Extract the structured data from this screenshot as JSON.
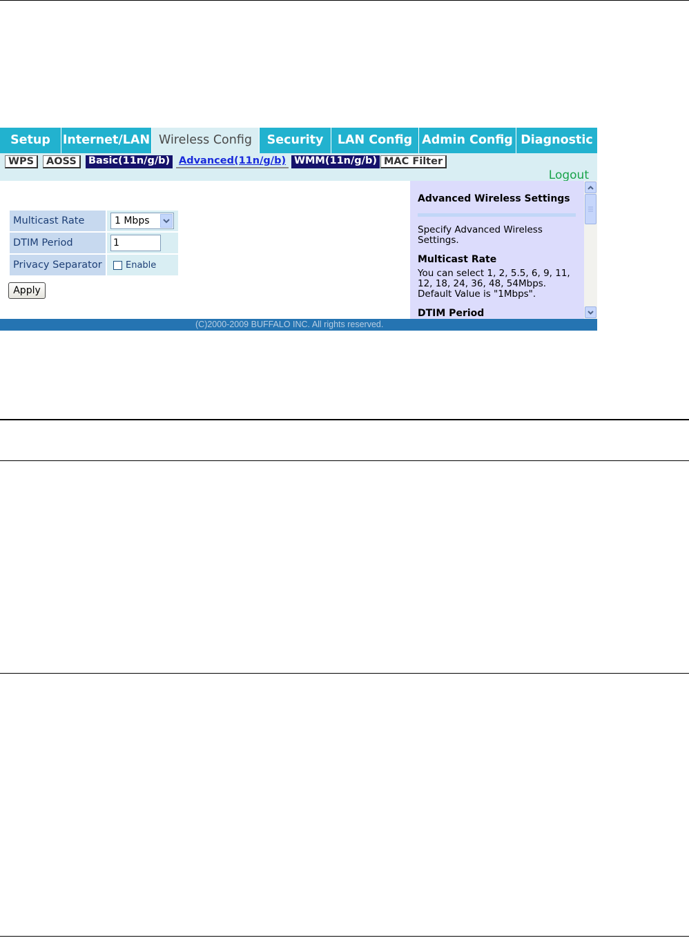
{
  "tabs": [
    {
      "label": "Setup",
      "active": false
    },
    {
      "label": "Internet/LAN",
      "active": false
    },
    {
      "label": "Wireless Config",
      "active": true
    },
    {
      "label": "Security",
      "active": false
    },
    {
      "label": "LAN Config",
      "active": false
    },
    {
      "label": "Admin Config",
      "active": false
    },
    {
      "label": "Diagnostic",
      "active": false
    }
  ],
  "subtabs": [
    {
      "label": "WPS",
      "style": "plain"
    },
    {
      "label": "AOSS",
      "style": "plain"
    },
    {
      "label": "Basic(11n/g/b)",
      "style": "dark"
    },
    {
      "label": "Advanced(11n/g/b)",
      "style": "link",
      "selected": true
    },
    {
      "label": "WMM(11n/g/b)",
      "style": "dark"
    },
    {
      "label": "MAC Filter",
      "style": "plain"
    }
  ],
  "logout_label": "Logout",
  "form": {
    "multicast_rate": {
      "label": "Multicast Rate",
      "value": "1 Mbps"
    },
    "dtim_period": {
      "label": "DTIM Period",
      "value": "1"
    },
    "privacy_separator": {
      "label": "Privacy Separator",
      "checkbox_label": "Enable",
      "checked": false
    },
    "apply_label": "Apply"
  },
  "help": {
    "title": "Advanced Wireless Settings",
    "intro": "Specify Advanced Wireless Settings.",
    "multicast_heading": "Multicast Rate",
    "multicast_text": "You can select 1, 2, 5.5, 6, 9, 11, 12, 18, 24, 36, 48, 54Mbps. Default Value is \"1Mbps\".",
    "dtim_heading": "DTIM Period"
  },
  "footer": "(C)2000-2009 BUFFALO INC. All rights reserved.",
  "colors": {
    "tab_bar": "#22b2cf",
    "active_tab": "#d9eef3",
    "subtab_dark": "#15126b",
    "logout": "#19a34a",
    "help_bg": "#dcdcfc",
    "footer_bg": "#2574b2"
  }
}
